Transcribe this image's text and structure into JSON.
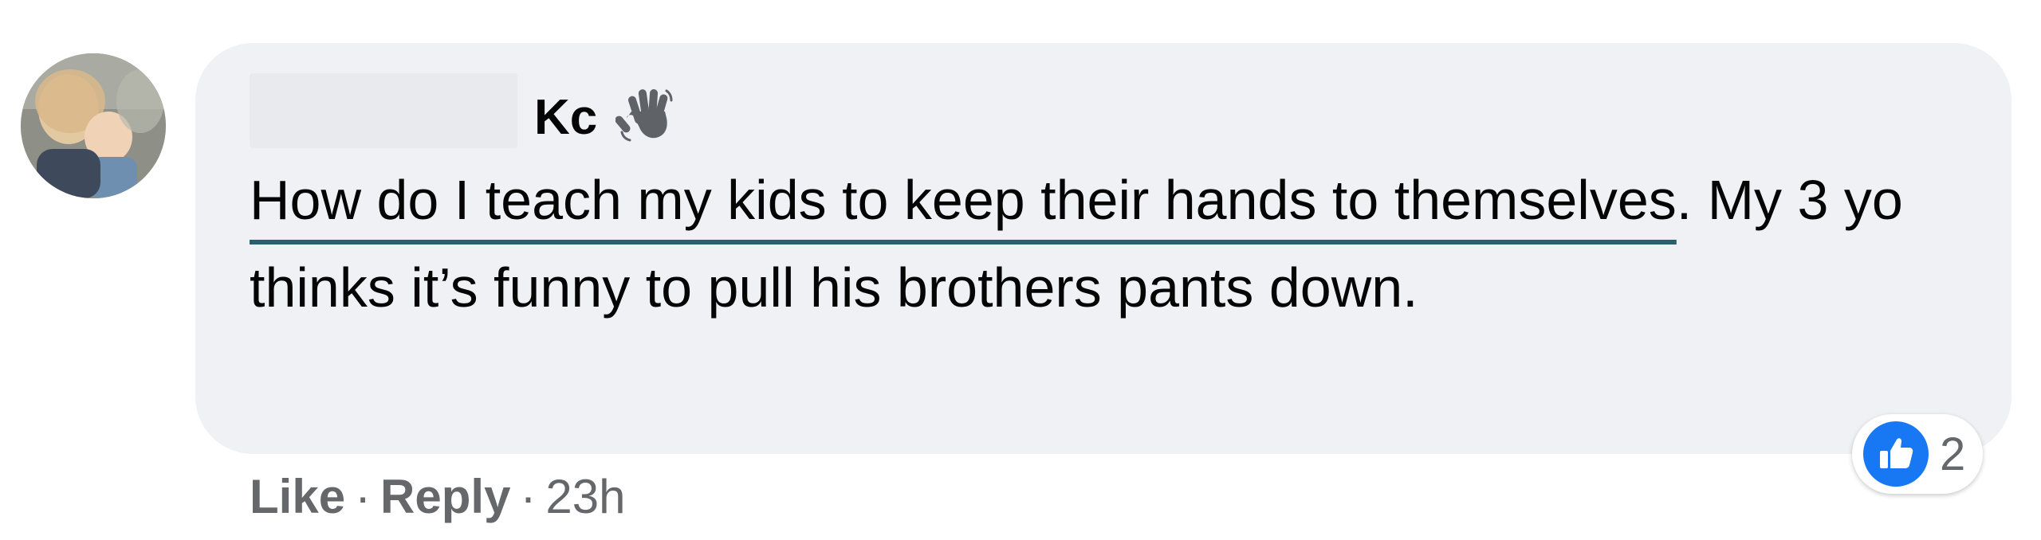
{
  "comment": {
    "author_name": "Kc",
    "author_icon": "waving-hand-icon",
    "text_link": "How do I teach my kids to keep their hands to themselves",
    "text_rest": ". My 3 yo thinks it’s funny to pull his brothers pants down."
  },
  "reactions": {
    "icon": "thumbs-up-icon",
    "count": "2",
    "color": "#1877f2"
  },
  "actions": {
    "like_label": "Like",
    "separator": "·",
    "reply_label": "Reply",
    "timestamp": "23h"
  },
  "colors": {
    "bubble": "#f0f1f5",
    "text": "#050505",
    "secondary": "#65676b",
    "underline": "#2a5f6e"
  }
}
